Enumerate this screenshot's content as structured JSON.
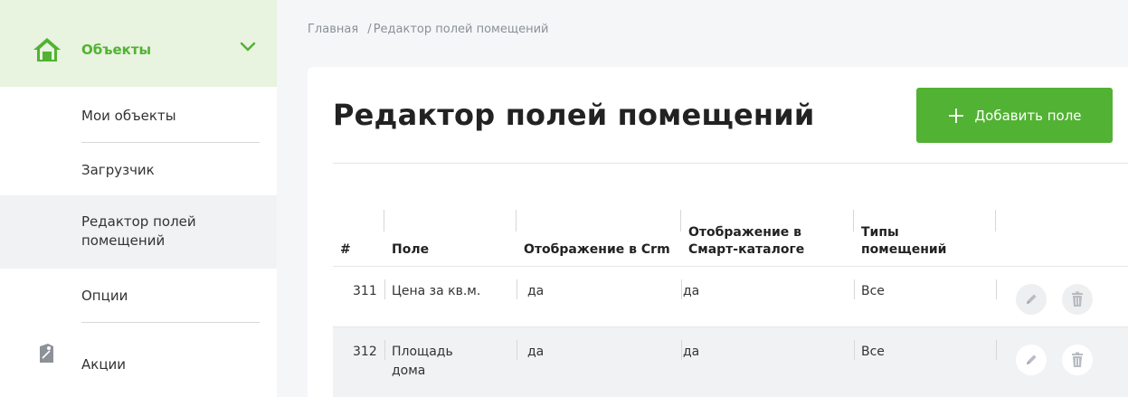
{
  "sidebar": {
    "section_label": "Объекты",
    "items": [
      {
        "label": "Мои объекты"
      },
      {
        "label": "Загрузчик"
      },
      {
        "label": "Редактор полей помещений"
      },
      {
        "label": "Опции"
      },
      {
        "label": "Акции"
      }
    ],
    "accent_color": "#52b233"
  },
  "breadcrumb": {
    "home": "Главная",
    "separator": "/",
    "current": "Редактор полей помещений"
  },
  "main": {
    "title": "Редактор полей помещений",
    "add_button": {
      "icon": "plus-icon",
      "label": "Добавить поле"
    }
  },
  "table": {
    "columns": [
      "#",
      "Поле",
      "Отображение в Crm",
      "Отображение в Смарт-каталоге",
      "Типы помещений"
    ],
    "rows": [
      {
        "id": "311",
        "field": "Цена за кв.м.",
        "crm": "да",
        "catalog": "да",
        "types": "Все"
      },
      {
        "id": "312",
        "field": "Площадь дома",
        "crm": "да",
        "catalog": "да",
        "types": "Все"
      }
    ],
    "row_actions": [
      "pencil-icon",
      "trash-icon"
    ]
  }
}
